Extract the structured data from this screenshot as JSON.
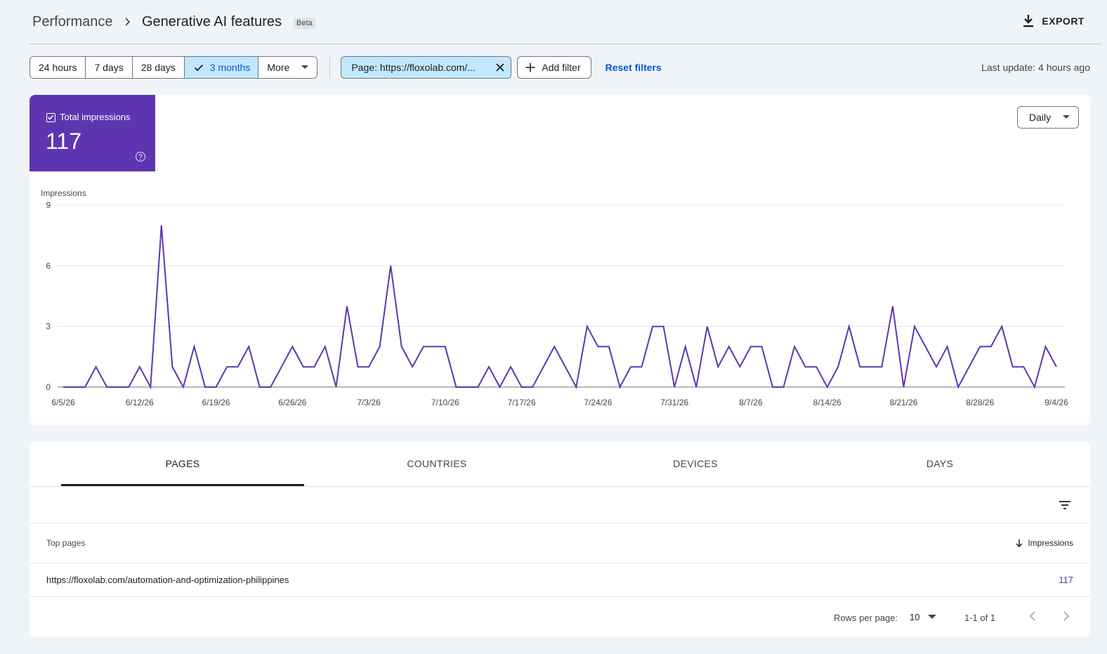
{
  "header": {
    "breadcrumb_root": "Performance",
    "title": "Generative AI features",
    "badge": "Beta",
    "export_label": "EXPORT"
  },
  "filters": {
    "date_ranges": [
      {
        "label": "24 hours",
        "active": false
      },
      {
        "label": "7 days",
        "active": false
      },
      {
        "label": "28 days",
        "active": false
      },
      {
        "label": "3 months",
        "active": true
      },
      {
        "label": "More",
        "active": false
      }
    ],
    "page_filter": "Page: https://floxolab.com/...",
    "add_filter": "Add filter",
    "reset": "Reset filters",
    "last_update": "Last update: 4 hours ago"
  },
  "metric": {
    "label": "Total impressions",
    "value": "117",
    "color": "#5e35b1"
  },
  "granularity": "Daily",
  "chart_data": {
    "type": "line",
    "ylabel": "Impressions",
    "ylim": [
      0,
      9
    ],
    "yticks": [
      0,
      3,
      6,
      9
    ],
    "xtick_labels": [
      "6/5/26",
      "6/12/26",
      "6/19/26",
      "6/26/26",
      "7/3/26",
      "7/10/26",
      "7/17/26",
      "7/24/26",
      "7/31/26",
      "8/7/26",
      "8/14/26",
      "8/21/26",
      "8/28/26",
      "9/4/26"
    ],
    "x_start": "6/5/26",
    "grid": true,
    "line_color": "#5e35b1",
    "series": [
      {
        "values": [
          0,
          0,
          0,
          1,
          0,
          0,
          0,
          1,
          0,
          8,
          1,
          0,
          2,
          0,
          0,
          1,
          1,
          2,
          0,
          0,
          1,
          2,
          1,
          1,
          2,
          0,
          4,
          1,
          1,
          2,
          6,
          2,
          1,
          2,
          2,
          2,
          0,
          0,
          0,
          1,
          0,
          1,
          0,
          0,
          1,
          2,
          1,
          0,
          3,
          2,
          2,
          0,
          1,
          1,
          3,
          3,
          0,
          2,
          0,
          3,
          1,
          2,
          1,
          2,
          2,
          0,
          0,
          2,
          1,
          1,
          0,
          1,
          3,
          1,
          1,
          1,
          4,
          0,
          3,
          2,
          1,
          2,
          0,
          1,
          2,
          2,
          3,
          1,
          1,
          0,
          2,
          1
        ]
      }
    ]
  },
  "tabs": [
    {
      "label": "PAGES",
      "active": true
    },
    {
      "label": "COUNTRIES",
      "active": false
    },
    {
      "label": "DEVICES",
      "active": false
    },
    {
      "label": "DAYS",
      "active": false
    }
  ],
  "table": {
    "col_page": "Top pages",
    "col_metric": "Impressions",
    "rows": [
      {
        "page": "https://floxolab.com/automation-and-optimization-philippines",
        "impressions": "117"
      }
    ]
  },
  "pager": {
    "rows_per_page_label": "Rows per page:",
    "rows_per_page": "10",
    "range": "1-1 of 1"
  }
}
